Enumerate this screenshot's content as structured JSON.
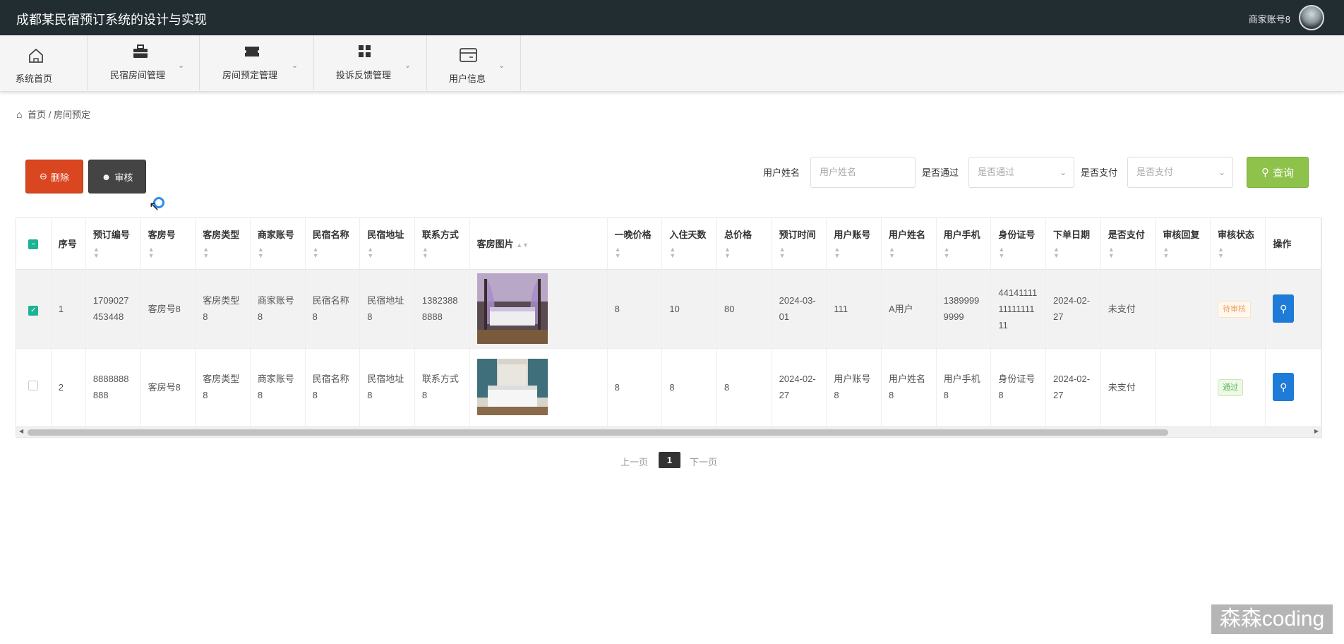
{
  "app": {
    "title": "成都某民宿预订系统的设计与实现",
    "user": "商家账号8"
  },
  "nav": {
    "home": "系统首页",
    "room_mgmt": "民宿房间管理",
    "booking_mgmt": "房间预定管理",
    "complaint_mgmt": "投诉反馈管理",
    "user_info": "用户信息"
  },
  "breadcrumb": {
    "home": "首页",
    "sep": "/",
    "current": "房间预定"
  },
  "toolbar": {
    "delete_label": "删除",
    "audit_label": "审核",
    "search_label": "查询"
  },
  "filters": {
    "username_label": "用户姓名",
    "username_placeholder": "用户姓名",
    "approved_label": "是否通过",
    "approved_placeholder": "是否通过",
    "paid_label": "是否支付",
    "paid_placeholder": "是否支付"
  },
  "table": {
    "headers": [
      "序号",
      "预订编号",
      "客房号",
      "客房类型",
      "商家账号",
      "民宿名称",
      "民宿地址",
      "联系方式",
      "客房图片",
      "一晚价格",
      "入住天数",
      "总价格",
      "预订时间",
      "用户账号",
      "用户姓名",
      "用户手机",
      "身份证号",
      "下单日期",
      "是否支付",
      "审核回复",
      "审核状态",
      "操作"
    ],
    "rows": [
      {
        "checked": true,
        "index": "1",
        "order_no": "1709027453448",
        "room_no": "客房号8",
        "room_type": "客房类型8",
        "merchant": "商家账号8",
        "bnb_name": "民宿名称8",
        "bnb_addr": "民宿地址8",
        "contact": "13823888888",
        "image": "purple-canopy-bed",
        "price": "8",
        "days": "10",
        "total": "80",
        "book_time": "2024-03-01",
        "user_acct": "111",
        "user_name": "A用户",
        "phone": "13899999999",
        "id_no": "441411111111111111",
        "order_date": "2024-02-27",
        "paid": "未支付",
        "reply": "",
        "status": "待审核"
      },
      {
        "checked": false,
        "index": "2",
        "order_no": "8888888888",
        "room_no": "客房号8",
        "room_type": "客房类型8",
        "merchant": "商家账号8",
        "bnb_name": "民宿名称8",
        "bnb_addr": "民宿地址8",
        "contact": "联系方式8",
        "image": "white-bed-window",
        "price": "8",
        "days": "8",
        "total": "8",
        "book_time": "2024-02-27",
        "user_acct": "用户账号8",
        "user_name": "用户姓名8",
        "phone": "用户手机8",
        "id_no": "身份证号8",
        "order_date": "2024-02-27",
        "paid": "未支付",
        "reply": "",
        "status": "通过"
      }
    ]
  },
  "pager": {
    "prev": "上一页",
    "current": "1",
    "next": "下一页"
  },
  "watermark": "森森coding",
  "colors": {
    "topbar": "#222d32",
    "delete": "#d9461f",
    "audit": "#444444",
    "search": "#8ec24a",
    "check": "#1cb394",
    "op": "#1e7bd8"
  }
}
